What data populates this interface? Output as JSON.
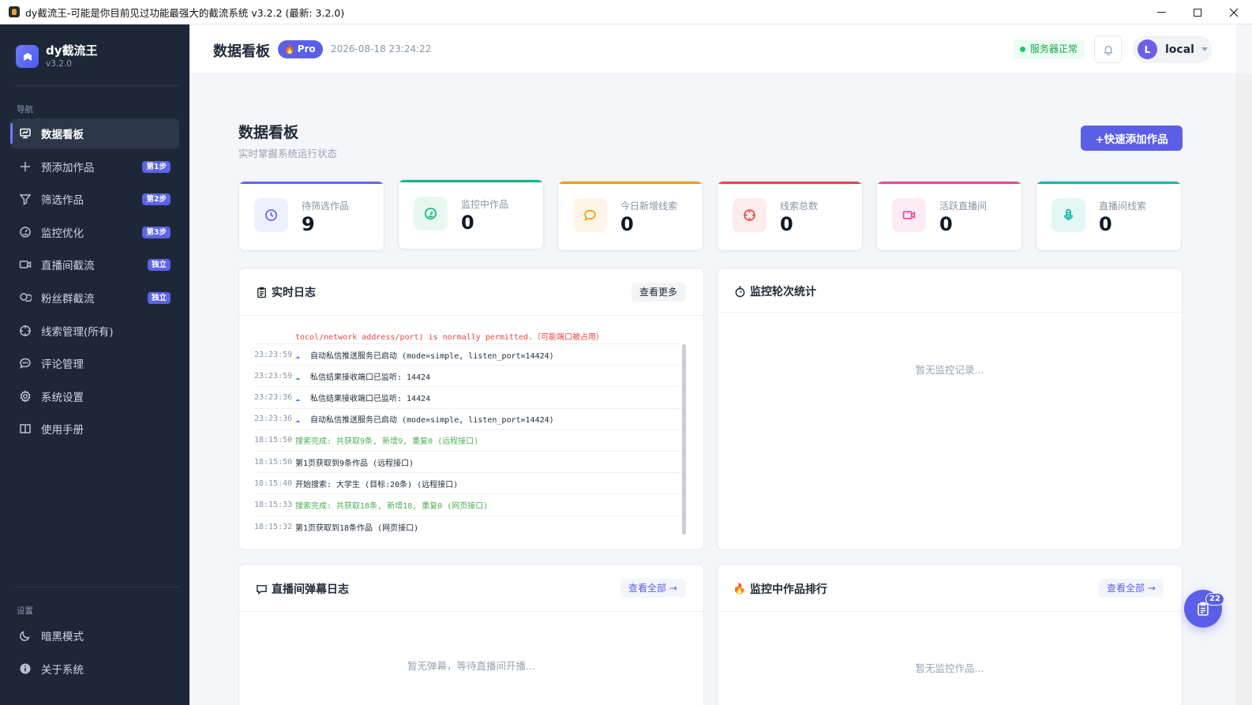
{
  "window": {
    "title": "dy截流王-可能是你目前见过功能最强大的截流系统 v3.2.2 (最新: 3.2.0)"
  },
  "brand": {
    "name": "dy截流王",
    "version": "v3.2.0"
  },
  "sidebar": {
    "nav_section": "导航",
    "items": [
      {
        "label": "数据看板",
        "icon": "dashboard-icon",
        "badge": ""
      },
      {
        "label": "预添加作品",
        "icon": "plus-icon",
        "badge": "第1步"
      },
      {
        "label": "筛选作品",
        "icon": "filter-icon",
        "badge": "第2步"
      },
      {
        "label": "监控优化",
        "icon": "gauge-icon",
        "badge": "第3步"
      },
      {
        "label": "直播间截流",
        "icon": "video-icon",
        "badge": "独立"
      },
      {
        "label": "粉丝群截流",
        "icon": "group-chat-icon",
        "badge": "独立"
      },
      {
        "label": "线索管理(所有)",
        "icon": "target-icon",
        "badge": ""
      },
      {
        "label": "评论管理",
        "icon": "comment-icon",
        "badge": ""
      },
      {
        "label": "系统设置",
        "icon": "gear-icon",
        "badge": ""
      },
      {
        "label": "使用手册",
        "icon": "book-icon",
        "badge": ""
      }
    ],
    "settings_section": "设置",
    "bottom_items": [
      {
        "label": "暗黑模式",
        "icon": "moon-icon"
      },
      {
        "label": "关于系统",
        "icon": "info-icon"
      }
    ]
  },
  "header": {
    "title": "数据看板",
    "pro_label": "Pro",
    "datetime": "2026-08-18 23:24:22",
    "status": "服务器正常",
    "user_initial": "L",
    "user_name": "local"
  },
  "page": {
    "title": "数据看板",
    "subtitle": "实时掌握系统运行状态",
    "quick_add": "+快速添加作品"
  },
  "stats": [
    {
      "label": "待筛选作品",
      "value": "9",
      "color": "#6366f1",
      "bg": "#eef0ff",
      "icon": "clock-icon"
    },
    {
      "label": "监控中作品",
      "value": "0",
      "color": "#10b981",
      "bg": "#e7f8f0",
      "icon": "gauge-icon"
    },
    {
      "label": "今日新增线索",
      "value": "0",
      "color": "#f59e0b",
      "bg": "#fef5e6",
      "icon": "chat-bubble-icon"
    },
    {
      "label": "线索总数",
      "value": "0",
      "color": "#ef4444",
      "bg": "#fdecec",
      "icon": "crosshair-icon"
    },
    {
      "label": "活跃直播间",
      "value": "0",
      "color": "#ec4899",
      "bg": "#fdebf3",
      "icon": "video-icon"
    },
    {
      "label": "直播间线索",
      "value": "0",
      "color": "#14b8a6",
      "bg": "#e3f7f4",
      "icon": "microphone-icon"
    }
  ],
  "panels": {
    "log": {
      "title": "实时日志",
      "more": "查看更多",
      "cut_line": "tocol/network address/port) is normally permitted.（可能端口被占用）",
      "rows": [
        {
          "time": "23:23:59",
          "msg": "自动私信推送服务已启动 (mode=simple, listen_port=14424)",
          "cloud": true,
          "tone": "normal"
        },
        {
          "time": "23:23:59",
          "msg": "私信结果接收端口已监听: 14424",
          "cloud": true,
          "tone": "normal"
        },
        {
          "time": "23:23:36",
          "msg": "私信结果接收端口已监听: 14424",
          "cloud": true,
          "tone": "normal"
        },
        {
          "time": "23:23:36",
          "msg": "自动私信推送服务已启动 (mode=simple, listen_port=14424)",
          "cloud": true,
          "tone": "normal"
        },
        {
          "time": "18:15:50",
          "msg": "搜索完成: 共获取9条, 新增9, 重复0 (远程接口)",
          "cloud": false,
          "tone": "green"
        },
        {
          "time": "18:15:50",
          "msg": "第1页获取到9条作品 (远程接口)",
          "cloud": false,
          "tone": "normal"
        },
        {
          "time": "18:15:40",
          "msg": "开始搜索: 大学生 (目标:20条) (远程接口)",
          "cloud": false,
          "tone": "normal"
        },
        {
          "time": "18:15:33",
          "msg": "搜索完成: 共获取18条, 新增18, 重复0 (网页接口)",
          "cloud": false,
          "tone": "green"
        },
        {
          "time": "18:15:32",
          "msg": "第1页获取到18条作品 (网页接口)",
          "cloud": false,
          "tone": "normal"
        }
      ]
    },
    "rounds": {
      "title": "监控轮次统计",
      "empty": "暂无监控记录..."
    },
    "danmaku": {
      "title": "直播间弹幕日志",
      "more": "查看全部 →",
      "empty": "暂无弹幕，等待直播间开播..."
    },
    "ranking": {
      "title": "监控中作品排行",
      "more": "查看全部 →",
      "empty": "暂无监控作品..."
    }
  },
  "fab": {
    "badge": "22"
  }
}
